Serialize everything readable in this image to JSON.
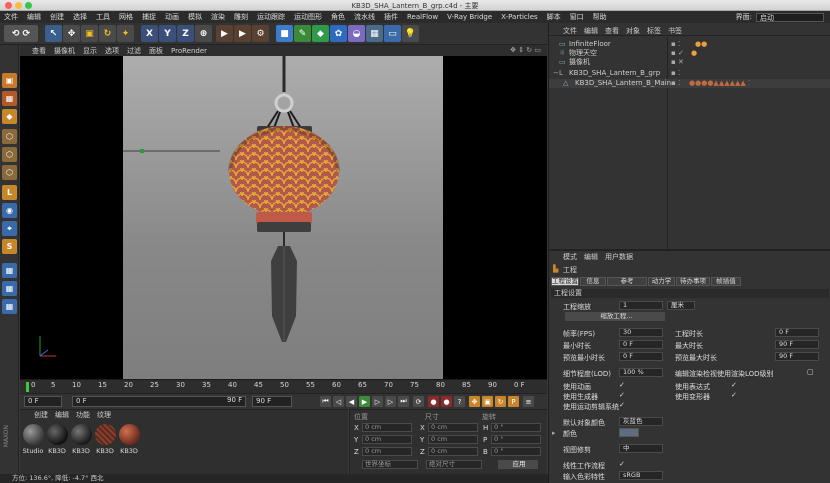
{
  "window": {
    "title": "KB3D_SHA_Lantern_B_grp.c4d - 主要"
  },
  "menubar": {
    "items": [
      "文件",
      "编辑",
      "创建",
      "选择",
      "工具",
      "网格",
      "捕捉",
      "动画",
      "模拟",
      "渲染",
      "雕刻",
      "运动跟踪",
      "运动图形",
      "角色",
      "流水线",
      "插件",
      "RealFlow",
      "V-Ray Bridge",
      "X-Particles",
      "脚本",
      "窗口",
      "帮助"
    ],
    "interface_label": "界面:",
    "interface_value": "启动"
  },
  "viewport": {
    "menu": [
      "查看",
      "摄像机",
      "显示",
      "选项",
      "过滤",
      "面板",
      "ProRender"
    ]
  },
  "timeline": {
    "ticks": [
      "0",
      "5",
      "10",
      "15",
      "20",
      "25",
      "30",
      "35",
      "40",
      "45",
      "50",
      "55",
      "60",
      "65",
      "70",
      "75",
      "80",
      "85",
      "90"
    ],
    "end_label": "0 F"
  },
  "timectrl": {
    "current": "0 F",
    "start": "0 F",
    "end": "90 F",
    "end2": "90 F"
  },
  "materials": {
    "menu": [
      "创建",
      "编辑",
      "功能",
      "纹理"
    ],
    "items": [
      {
        "label": "Studio",
        "color": "#4a4a4a"
      },
      {
        "label": "KB3D",
        "color": "#1a1a1a"
      },
      {
        "label": "KB3D",
        "color": "#222"
      },
      {
        "label": "KB3D",
        "color": "#8a3f2c"
      },
      {
        "label": "KB3D",
        "color": "#a14a30"
      }
    ]
  },
  "coords": {
    "headers": [
      "位置",
      "尺寸",
      "旋转"
    ],
    "rows": [
      {
        "axis": "X",
        "pos": "0 cm",
        "size": "0 cm",
        "rot_axis": "H",
        "rot": "0 °"
      },
      {
        "axis": "Y",
        "pos": "0 cm",
        "size": "0 cm",
        "rot_axis": "P",
        "rot": "0 °"
      },
      {
        "axis": "Z",
        "pos": "0 cm",
        "size": "0 cm",
        "rot_axis": "B",
        "rot": "0 °"
      }
    ],
    "mode": "世界坐标",
    "scale": "绝对尺寸",
    "apply": "应用"
  },
  "status": {
    "text": "方位: 136.6°, 降低: -4.7° 西北"
  },
  "objects": {
    "menu": [
      "文件",
      "编辑",
      "查看",
      "对象",
      "标签",
      "书签"
    ],
    "items": [
      "InfiniteFloor",
      "物理天空",
      "摄像机",
      "KB3D_SHA_Lantern_B_grp",
      "KB3D_SHA_Lantern_B_Main"
    ]
  },
  "attributes": {
    "menu": [
      "模式",
      "编辑",
      "用户数据"
    ],
    "title": "工程",
    "tabs": [
      "工程设置",
      "信息",
      "参考",
      "动力学",
      "待办事项",
      "帧插值"
    ],
    "section": "工程设置",
    "scale_label": "工程缩放",
    "scale_value": "1",
    "scale_unit": "厘米",
    "scale_button": "缩放工程...",
    "fps_label": "帧率(FPS)",
    "fps": "30",
    "proj_time_label": "工程时长",
    "proj_time": "0 F",
    "min_time_label": "最小时长",
    "min_time": "0 F",
    "max_time_label": "最大时长",
    "max_time": "90 F",
    "prev_min_label": "预览最小时长",
    "prev_min": "0 F",
    "prev_max_label": "预览最大时长",
    "prev_max": "90 F",
    "lod_label": "细节程度(LOD)",
    "lod": "100 %",
    "lod_note": "编辑渲染检视使用渲染LOD级别",
    "anim_label": "使用动画",
    "expr_label": "使用表达式",
    "gen_label": "使用生成器",
    "deform_label": "使用变形器",
    "motion_label": "使用运动剪辑系统",
    "default_color_label": "默认对象颜色",
    "default_color": "灰蓝色",
    "color_label": "颜色",
    "clip_label": "视图修剪",
    "clip_value": "中",
    "linear_label": "线性工作流程",
    "input_color_label": "输入色彩特性",
    "input_color_value": "sRGB"
  }
}
